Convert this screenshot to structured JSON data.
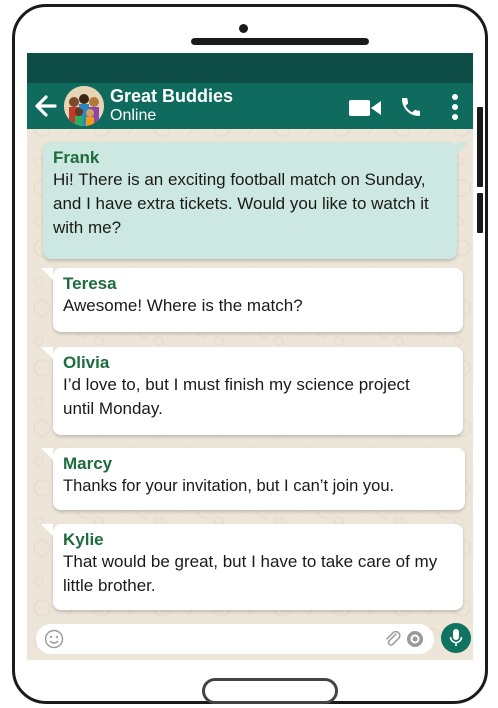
{
  "header": {
    "group_name": "Great Buddies",
    "status": "Online"
  },
  "messages": [
    {
      "sender": "Frank",
      "text": "Hi! There is an exciting football match on Sunday, and I have extra tickets. Would you like to watch it with me?",
      "type": "sent"
    },
    {
      "sender": "Teresa",
      "text": "Awesome! Where is the match?",
      "type": "received"
    },
    {
      "sender": "Olivia",
      "text": "I’d love to, but I must finish my science project until Monday.",
      "type": "received"
    },
    {
      "sender": "Marcy",
      "text": "Thanks for your invitation, but I can’t join you.",
      "type": "received"
    },
    {
      "sender": "Kylie",
      "text": "That would be great, but I have to take care of my little brother.",
      "type": "received"
    }
  ],
  "icons": {
    "back": "arrow-left-icon",
    "video": "video-camera-icon",
    "call": "phone-icon",
    "menu": "more-vertical-icon",
    "emoji": "emoji-icon",
    "attach": "paperclip-icon",
    "camera": "camera-icon",
    "mic": "microphone-icon"
  },
  "colors": {
    "header": "#0f6b5e",
    "status_bar": "#0d4d45",
    "sent_bubble": "#cde8e0",
    "received_bubble": "#ffffff",
    "sender_name": "#1d6b3e",
    "chat_background": "#ece5d8",
    "mic_button": "#10735f"
  }
}
